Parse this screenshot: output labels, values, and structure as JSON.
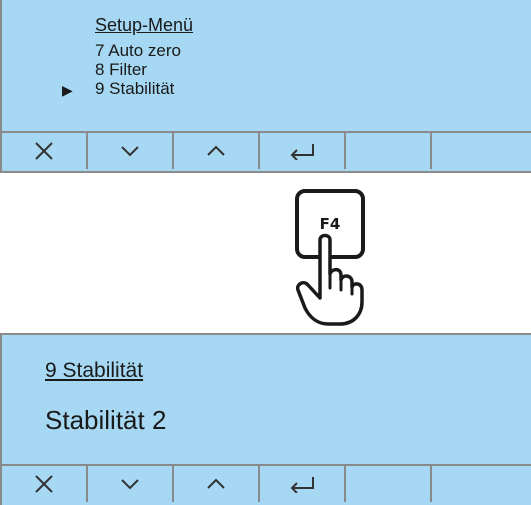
{
  "top_screen": {
    "menu_title": "Setup-Menü",
    "items": [
      {
        "label": "7 Auto zero"
      },
      {
        "label": "8 Filter"
      },
      {
        "label": "9 Stabilität"
      }
    ],
    "cursor": "▶",
    "selected_index": 2
  },
  "key": {
    "label": "F4"
  },
  "bottom_screen": {
    "title": "9 Stabilität",
    "value": "Stabilität 2"
  },
  "softkeys": [
    {
      "icon": "close-icon"
    },
    {
      "icon": "chevron-down-icon"
    },
    {
      "icon": "chevron-up-icon"
    },
    {
      "icon": "enter-icon"
    },
    {
      "icon": ""
    },
    {
      "icon": ""
    }
  ],
  "colors": {
    "lcd_background": "#a6d8f3",
    "border": "#8a8a8a",
    "text": "#1a1a1a"
  }
}
